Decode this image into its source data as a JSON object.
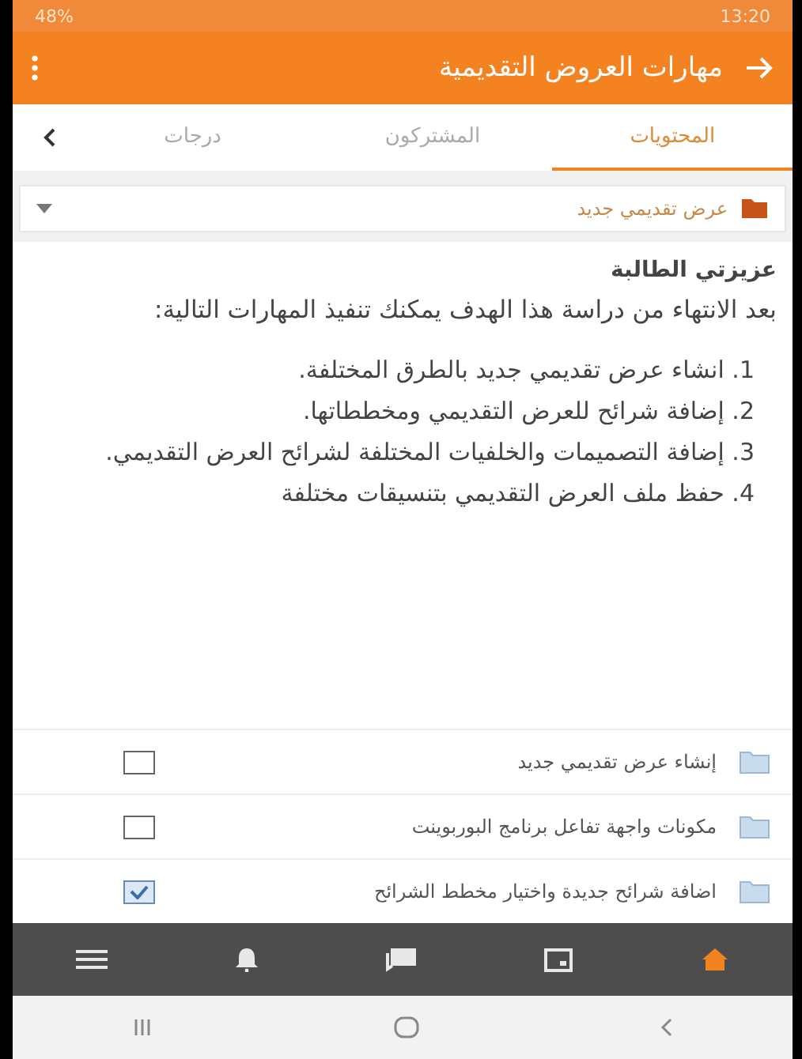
{
  "status_bar": {
    "time": "13:20",
    "battery": "48%"
  },
  "app_bar": {
    "title": "مهارات العروض التقديمية"
  },
  "tabs": [
    {
      "label": "المحتويات",
      "selected": true
    },
    {
      "label": "المشتركون",
      "selected": false
    },
    {
      "label": "درجات",
      "selected": false
    }
  ],
  "section_select": {
    "value": "عرض تقديمي جديد"
  },
  "intro": {
    "heading": "عزيزتي الطالبة",
    "text": "بعد الانتهاء من دراسة هذا الهدف يمكنك تنفيذ المهارات التالية:",
    "items": [
      "1. انشاء عرض تقديمي جديد بالطرق المختلفة.",
      "2. إضافة شرائح للعرض التقديمي ومخططاتها.",
      "3. إضافة التصميمات والخلفيات المختلفة لشرائح العرض التقديمي.",
      "4. حفظ ملف العرض التقديمي بتنسيقات مختلفة"
    ]
  },
  "lessons": [
    {
      "title": "إنشاء عرض تقديمي جديد",
      "checked": false
    },
    {
      "title": "مكونات واجهة تفاعل برنامج البوربوينت",
      "checked": false
    },
    {
      "title": "اضافة شرائح جديدة واختيار مخطط الشرائح",
      "checked": true
    }
  ],
  "bottom_nav": [
    {
      "kind": "home",
      "selected": true
    },
    {
      "kind": "calendar",
      "selected": false
    },
    {
      "kind": "messages",
      "selected": false
    },
    {
      "kind": "bell",
      "selected": false
    },
    {
      "kind": "menu",
      "selected": false
    }
  ]
}
